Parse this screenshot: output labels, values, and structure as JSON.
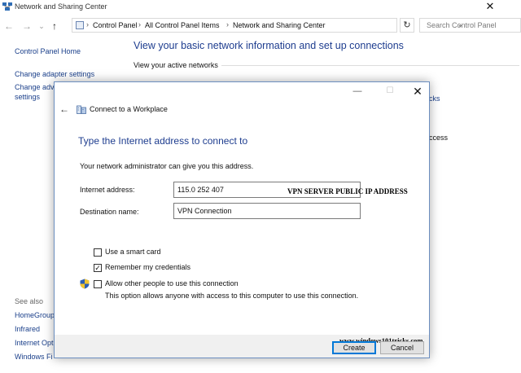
{
  "window": {
    "title": "Network and Sharing Center",
    "close_glyph": "✕",
    "icon": "network-center-icon"
  },
  "address_bar": {
    "back_glyph": "←",
    "forward_glyph": "→",
    "recent_glyph": "⌄",
    "up_glyph": "↑",
    "breadcrumbs": [
      "Control Panel",
      "All Control Panel Items",
      "Network and Sharing Center"
    ],
    "separator": "›",
    "refresh_glyph": "↻",
    "search_placeholder": "Search Control Panel"
  },
  "sidebar": {
    "links": [
      "Control Panel Home",
      "Change adapter settings",
      "Change adv",
      "settings"
    ],
    "see_also_title": "See also",
    "see_also": [
      "HomeGroup",
      "Infrared",
      "Internet Opt",
      "Windows Fi"
    ]
  },
  "main": {
    "heading": "View your basic network information and set up connections",
    "active_networks_label": "View your active networks",
    "peek_right": [
      "cks",
      "ccess"
    ]
  },
  "dialog": {
    "title": "Connect to a Workplace",
    "min_glyph": "—",
    "max_glyph": "☐",
    "close_glyph": "✕",
    "back_glyph": "←",
    "heading": "Type the Internet address to connect to",
    "instruction": "Your network administrator can give you this address.",
    "internet_address_label": "Internet address:",
    "internet_address_value": "115.0 252 407",
    "annotation": "VPN SERVER PUBLIC IP ADDRESS",
    "destination_label": "Destination name:",
    "destination_value": "VPN Connection",
    "smart_card_label": "Use a smart card",
    "smart_card_checked": false,
    "remember_label": "Remember my credentials",
    "remember_checked": true,
    "allow_label": "Allow other people to use this connection",
    "allow_checked": false,
    "allow_note": "This option allows anyone with access to this computer to use this connection.",
    "watermark": "www.windows101tricks.com",
    "create_label": "Create",
    "cancel_label": "Cancel"
  },
  "colors": {
    "heading_blue": "#1e3d8f",
    "link_blue": "#1a3f8a",
    "dialog_border": "#6c8ebf",
    "default_button_border": "#0078d7"
  }
}
